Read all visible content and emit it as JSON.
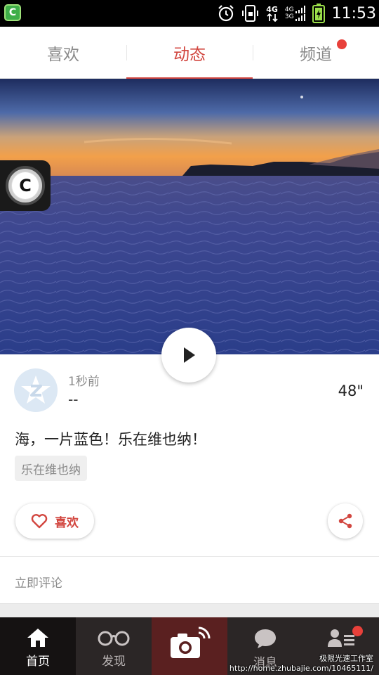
{
  "status_bar": {
    "network_top": "4G",
    "network_small_1": "4G",
    "network_small_2": "3G",
    "time": "11:53",
    "icons": [
      "app-shield-icon",
      "alarm-icon",
      "vibrate-icon",
      "data-arrows-icon",
      "signal-icon",
      "battery-icon"
    ]
  },
  "top_tabs": [
    {
      "label": "喜欢",
      "active": false
    },
    {
      "label": "动态",
      "active": true
    },
    {
      "label": "频道",
      "active": false,
      "has_badge": true
    }
  ],
  "floating_button": {
    "letter": "C"
  },
  "post": {
    "time_ago": "1秒前",
    "username": "--",
    "duration": "48\"",
    "text": "海，一片蓝色！乐在维也纳！",
    "tag": "乐在维也纳",
    "like_label": "喜欢",
    "comment_prompt": "立即评论"
  },
  "bottom_nav": [
    {
      "label": "首页",
      "icon": "home-icon",
      "active": true
    },
    {
      "label": "发现",
      "icon": "glasses-icon",
      "active": false
    },
    {
      "label": "",
      "icon": "camera-icon",
      "active": false
    },
    {
      "label": "消息",
      "icon": "chat-bubble-icon",
      "active": false
    },
    {
      "label": "",
      "icon": "contacts-icon",
      "active": false,
      "has_badge": true
    }
  ],
  "watermark": {
    "line1": "极限光速工作室",
    "line2": "http://home.zhubajie.com/10465111/"
  },
  "colors": {
    "accent": "#d2463f",
    "badge": "#e8403a",
    "bottom_nav_bg": "#2b2626",
    "camera_tab_bg": "#5a2020"
  }
}
